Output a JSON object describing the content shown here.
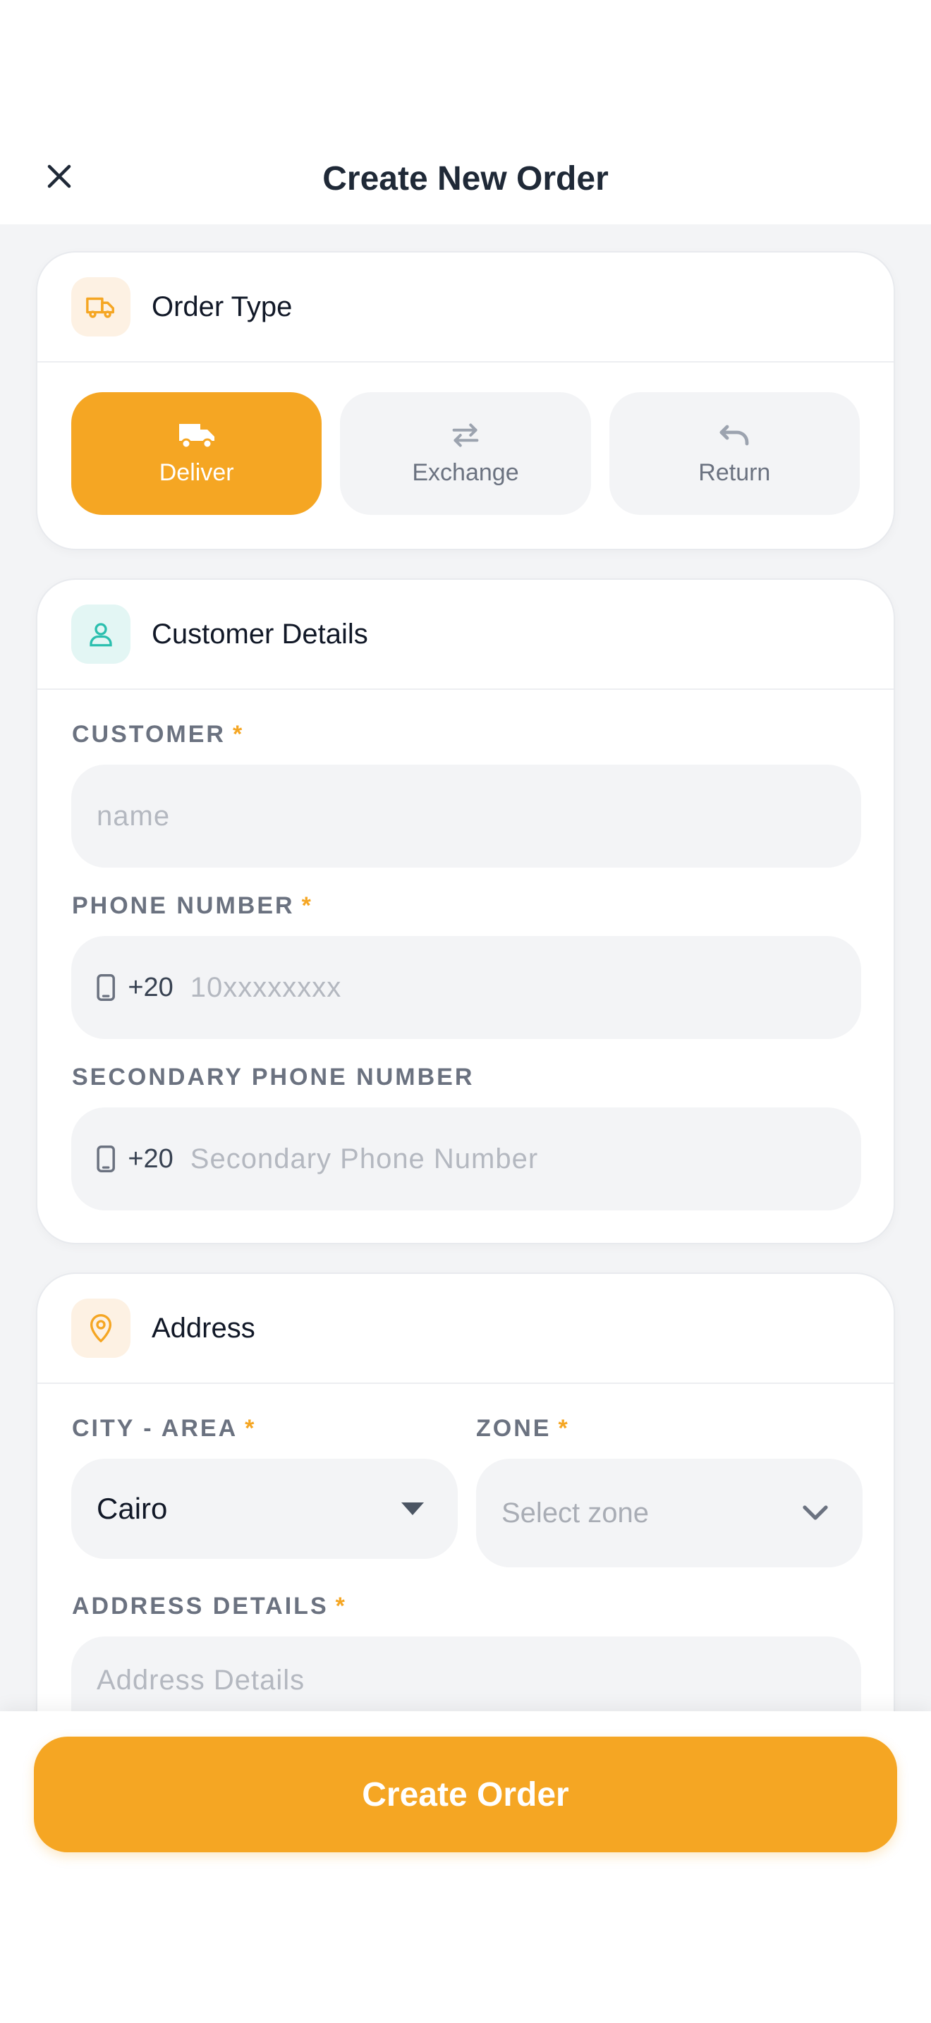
{
  "header": {
    "title": "Create New Order",
    "close_icon": "close-icon"
  },
  "order_type": {
    "title": "Order Type",
    "icon": "truck-icon",
    "options": [
      {
        "label": "Deliver",
        "icon": "truck-icon",
        "active": true
      },
      {
        "label": "Exchange",
        "icon": "swap-arrows-icon",
        "active": false
      },
      {
        "label": "Return",
        "icon": "undo-icon",
        "active": false
      }
    ]
  },
  "customer": {
    "title": "Customer Details",
    "icon": "user-icon",
    "customer_label": "CUSTOMER",
    "customer_placeholder": "name",
    "phone_label": "PHONE NUMBER",
    "phone_prefix": "+20",
    "phone_placeholder": "10xxxxxxxx",
    "secondary_label": "SECONDARY PHONE NUMBER",
    "secondary_prefix": "+20",
    "secondary_placeholder": "Secondary Phone Number",
    "required_mark": "*"
  },
  "address": {
    "title": "Address",
    "icon": "map-pin-icon",
    "city_label": "CITY - AREA",
    "city_value": "Cairo",
    "zone_label": "ZONE",
    "zone_placeholder": "Select zone",
    "details_label": "ADDRESS DETAILS",
    "details_placeholder": "Address Details",
    "required_mark": "*"
  },
  "footer": {
    "create_label": "Create Order"
  },
  "colors": {
    "accent": "#F5A623",
    "teal": "#2BBFAE",
    "muted": "#6B7280"
  }
}
